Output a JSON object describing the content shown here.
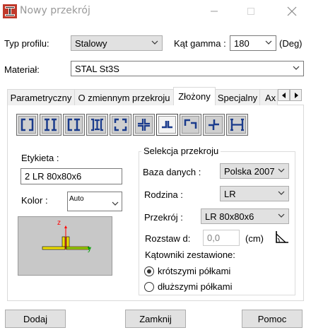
{
  "window": {
    "title": "Nowy przekrój",
    "controls": [
      "minimize-icon",
      "maximize-icon",
      "close-icon"
    ]
  },
  "profile_type": {
    "label": "Typ profilu:",
    "value": "Stalowy"
  },
  "gamma_angle": {
    "label": "Kąt gamma :",
    "value": "180",
    "unit": "(Deg)"
  },
  "material": {
    "label": "Materiał:",
    "value": "STAL St3S"
  },
  "tabs": [
    {
      "label": "Parametryczny",
      "active": false
    },
    {
      "label": "O zmiennym przekroju",
      "active": false
    },
    {
      "label": "Złożony",
      "active": true
    },
    {
      "label": "Specjalny",
      "active": false
    },
    {
      "label": "Ax",
      "active": false
    }
  ],
  "profile_buttons": [
    {
      "icon": "double-channel-outward-icon",
      "selected": false
    },
    {
      "icon": "double-i-beam-icon",
      "selected": false
    },
    {
      "icon": "channel-i-beam-icon",
      "selected": false
    },
    {
      "icon": "i-beam-channels-icon",
      "selected": false
    },
    {
      "icon": "four-angles-box-icon",
      "selected": false
    },
    {
      "icon": "four-angles-cross-icon",
      "selected": false
    },
    {
      "icon": "double-angle-tee-icon",
      "selected": true
    },
    {
      "icon": "double-angle-box-icon",
      "selected": false
    },
    {
      "icon": "double-angle-star-icon",
      "selected": false
    },
    {
      "icon": "i-beam-side-plates-icon",
      "selected": false
    }
  ],
  "label_field": {
    "label": "Etykieta :",
    "value": "2 LR 80x80x6"
  },
  "color_field": {
    "label": "Kolor :",
    "value": "Auto"
  },
  "preview": {
    "axis_z": "z",
    "axis_y": "y",
    "colors": {
      "background": "#c8c8c8",
      "section": "#f0e000",
      "axis_z": "#ff0000",
      "axis_y": "#00a000"
    }
  },
  "selection": {
    "title": "Selekcja przekroju",
    "database": {
      "label": "Baza danych :",
      "value": "Polska 2007"
    },
    "family": {
      "label": "Rodzina :",
      "value": "LR"
    },
    "section": {
      "label": "Przekrój :",
      "value": "LR 80x80x6"
    },
    "spacing": {
      "label": "Rozstaw  d:",
      "value": "0,0",
      "unit": "(cm)"
    },
    "angles_title": "Kątowniki zestawione:",
    "radio_short": {
      "label": "krótszymi półkami",
      "checked": true
    },
    "radio_long": {
      "label": "dłuższymi półkami",
      "checked": false
    }
  },
  "buttons": {
    "add": "Dodaj",
    "close": "Zamknij",
    "help": "Pomoc"
  }
}
